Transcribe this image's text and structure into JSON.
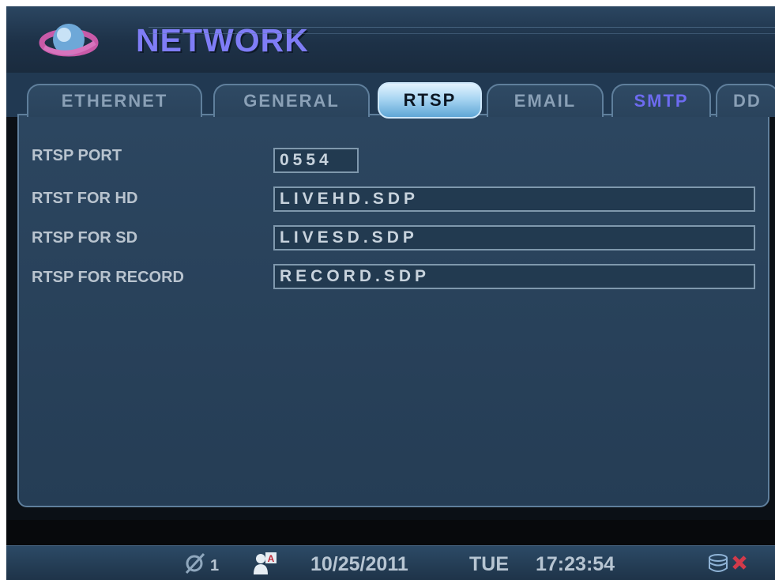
{
  "header": {
    "title": "NETWORK",
    "logo_icon": "globe-icon"
  },
  "tabs": [
    {
      "label": "ETHERNET",
      "active": false
    },
    {
      "label": "GENERAL",
      "active": false
    },
    {
      "label": "RTSP",
      "active": true
    },
    {
      "label": "EMAIL",
      "active": false
    },
    {
      "label": "SMTP",
      "active": false,
      "color": "#6d6bf0"
    },
    {
      "label": "DD",
      "active": false
    }
  ],
  "form": {
    "rtsp_port": {
      "label": "RTSP PORT",
      "value": "0554"
    },
    "rtsp_hd": {
      "label": "RTST FOR HD",
      "value": "LIVEHD.SDP"
    },
    "rtsp_sd": {
      "label": "RTSP FOR SD",
      "value": "LIVESD.SDP"
    },
    "rtsp_record": {
      "label": "RTSP FOR RECORD",
      "value": "RECORD.SDP"
    }
  },
  "status_bar": {
    "camera_icon": "camera-disabled-icon",
    "camera_count": "1",
    "user_icon": "user-admin-icon",
    "date": "10/25/2011",
    "weekday": "TUE",
    "time": "17:23:54",
    "hdd_icon": "hdd-icon",
    "hdd_status_icon": "error-x-icon"
  },
  "colors": {
    "title": "#7f7df6",
    "active_tab": "#a9d6f2",
    "panel": "#2c4660",
    "error": "#d23a4a"
  }
}
